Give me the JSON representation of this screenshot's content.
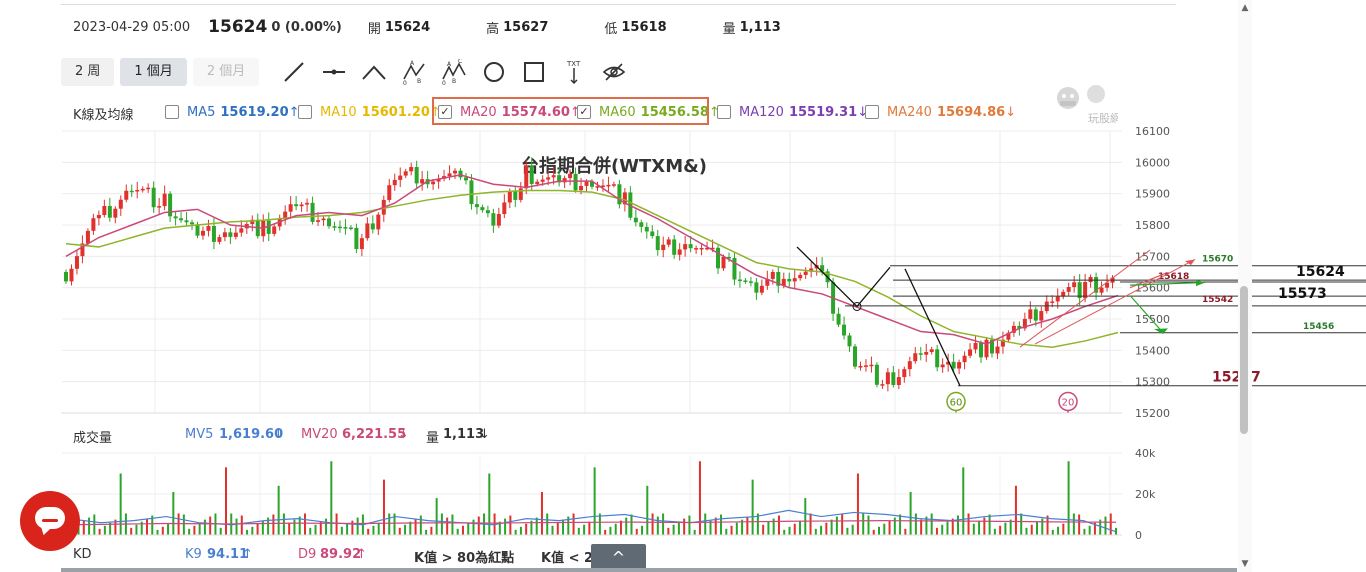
{
  "header": {
    "date": "2023-04-29 05:00",
    "close": "15624",
    "change": "0 (0.00%)",
    "open_label": "開",
    "open": "15624",
    "high_label": "高",
    "high": "15627",
    "low_label": "低",
    "low": "15618",
    "volume_label": "量",
    "volume": "1,113"
  },
  "toolbar": {
    "periods": [
      "2 周",
      "1 個月",
      "2 個月"
    ],
    "active_period": "1 個月",
    "tools": [
      "line-tool-icon",
      "horizontal-line-icon",
      "angle-line-icon",
      "abc-pattern-icon",
      "abcd-pattern-icon",
      "circle-tool-icon",
      "rectangle-tool-icon",
      "text-tool-icon",
      "hide-drawings-icon"
    ]
  },
  "ma_row": {
    "title": "K線及均線",
    "items": [
      {
        "label": "MA5",
        "value": "15619.20",
        "arrow": "↑",
        "checked": false,
        "color": "#2e6fc2"
      },
      {
        "label": "MA10",
        "value": "15601.20",
        "arrow": "↑",
        "checked": false,
        "color": "#e6b800"
      },
      {
        "label": "MA20",
        "value": "15574.60",
        "arrow": "↑",
        "checked": true,
        "color": "#c9497a"
      },
      {
        "label": "MA60",
        "value": "15456.58",
        "arrow": "↑",
        "checked": true,
        "color": "#7aaa1e"
      },
      {
        "label": "MA120",
        "value": "15519.31",
        "arrow": "↓",
        "checked": false,
        "color": "#7a3fb0"
      },
      {
        "label": "MA240",
        "value": "15694.86",
        "arrow": "↓",
        "checked": false,
        "color": "#e07a3a"
      }
    ],
    "check_mark": "✓"
  },
  "logo_text": "玩股網",
  "volume_row": {
    "title": "成交量",
    "mv5_label": "MV5",
    "mv5": "1,619.60",
    "mv5_arrow": "↓",
    "mv20_label": "MV20",
    "mv20": "6,221.55",
    "mv20_arrow": "↓",
    "vol_label": "量",
    "vol": "1,113",
    "vol_arrow": "↓"
  },
  "kd_row": {
    "title": "KD",
    "k_label": "K9",
    "k": "94.11",
    "k_arrow": "↑",
    "d_label": "D9",
    "d": "89.92",
    "d_arrow": "↑",
    "note1": "K值 > 80為紅點",
    "note2": "K值 < 2"
  },
  "collapse_label": "^",
  "colors": {
    "up": "#e0312c",
    "down": "#2aa52a",
    "ma20": "#c9497a",
    "ma60": "#8fb52a",
    "mv5": "#4a7fd0",
    "mv20": "#c9497a",
    "annotation": "#8b1a2a",
    "green_label": "#2a7a2a"
  },
  "chart_data": [
    {
      "type": "line",
      "title": "台指期合併(WTXM&)",
      "ylim": [
        15200,
        16100
      ],
      "yticks": [
        15200,
        15300,
        15400,
        15500,
        15600,
        15700,
        15800,
        15900,
        16000,
        16100
      ],
      "series": [
        {
          "name": "MA20",
          "values": [
            15700,
            15760,
            15800,
            15840,
            15850,
            15800,
            15790,
            15830,
            15840,
            15830,
            15870,
            15940,
            15960,
            15930,
            15920,
            15940,
            15940,
            15870,
            15820,
            15760,
            15700,
            15640,
            15600,
            15580,
            15540,
            15500,
            15460,
            15450,
            15420,
            15470,
            15500,
            15540,
            15575
          ]
        },
        {
          "name": "MA60",
          "values": [
            15740,
            15730,
            15760,
            15790,
            15800,
            15810,
            15815,
            15825,
            15830,
            15840,
            15860,
            15880,
            15895,
            15905,
            15910,
            15910,
            15905,
            15880,
            15830,
            15780,
            15730,
            15680,
            15660,
            15650,
            15620,
            15570,
            15510,
            15460,
            15440,
            15420,
            15410,
            15430,
            15457
          ]
        },
        {
          "name": "close",
          "values": [
            15650,
            15820,
            15920,
            15870,
            15760,
            15780,
            15790,
            15860,
            15820,
            15740,
            15950,
            15960,
            15940,
            15810,
            15960,
            15930,
            15940,
            15880,
            15720,
            15750,
            15680,
            15590,
            15650,
            15640,
            15360,
            15300,
            15380,
            15360,
            15410,
            15470,
            15580,
            15600,
            15624
          ]
        }
      ],
      "annotations": [
        "15670",
        "15618",
        "15624",
        "15573",
        "15542",
        "15456",
        "15287"
      ],
      "markers": [
        "60",
        "20"
      ]
    },
    {
      "type": "bar",
      "title": "成交量",
      "ylim": [
        0,
        40000
      ],
      "yticks": [
        "0",
        "20k",
        "40k"
      ],
      "series": [
        {
          "name": "MV5",
          "values": [
            8000,
            6000,
            7000,
            9000,
            6000,
            5000,
            7000,
            8000,
            6000,
            5000,
            9000,
            7000,
            6000,
            5000,
            8000,
            7000,
            9000,
            10000,
            7000,
            6000,
            8000,
            9000,
            12000,
            9000,
            11000,
            10000,
            8000,
            7000,
            9000,
            10000,
            8000,
            7000,
            1619.6
          ]
        },
        {
          "name": "MV20",
          "values": [
            5000,
            5200,
            5400,
            5600,
            5500,
            5400,
            5600,
            5800,
            5700,
            5600,
            5800,
            5900,
            5900,
            5800,
            6000,
            6100,
            6200,
            6300,
            6200,
            6100,
            6300,
            6500,
            6700,
            6800,
            6900,
            7000,
            6900,
            6800,
            6700,
            6600,
            6400,
            6300,
            6221.55
          ]
        }
      ]
    }
  ]
}
